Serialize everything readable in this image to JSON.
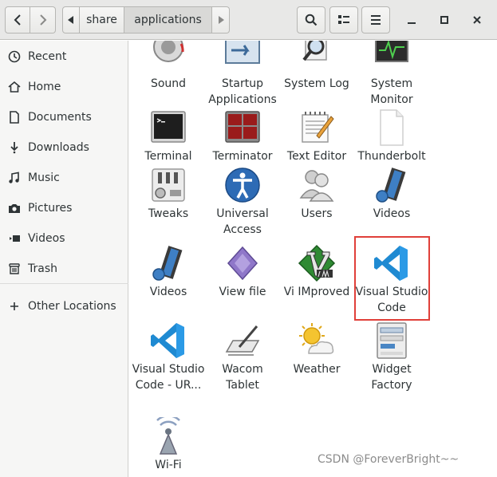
{
  "nav": {
    "back_icon": "chevron-left-icon",
    "forward_icon": "chevron-right-icon"
  },
  "path": {
    "segments": [
      "share",
      "applications"
    ]
  },
  "toolbar": {
    "search_icon": "search-icon",
    "view_icon": "view-toggle-icon",
    "menu_icon": "hamburger-menu-icon"
  },
  "window": {
    "minimize_icon": "minimize-icon",
    "maximize_icon": "maximize-icon",
    "close_icon": "close-icon"
  },
  "sidebar": {
    "items": [
      {
        "label": "Recent",
        "icon": "clock-icon"
      },
      {
        "label": "Home",
        "icon": "home-icon"
      },
      {
        "label": "Documents",
        "icon": "document-icon"
      },
      {
        "label": "Downloads",
        "icon": "download-icon"
      },
      {
        "label": "Music",
        "icon": "music-icon"
      },
      {
        "label": "Pictures",
        "icon": "camera-icon"
      },
      {
        "label": "Videos",
        "icon": "video-icon"
      },
      {
        "label": "Trash",
        "icon": "trash-icon"
      },
      {
        "label": "Other Locations",
        "icon": "plus-icon"
      }
    ]
  },
  "files": [
    {
      "label": "Sound",
      "icon": "sound-icon"
    },
    {
      "label": "Startup Applications",
      "icon": "startup-icon"
    },
    {
      "label": "System Log",
      "icon": "system-log-icon"
    },
    {
      "label": "System Monitor",
      "icon": "system-monitor-icon"
    },
    {
      "label": "Terminal",
      "icon": "terminal-icon"
    },
    {
      "label": "Terminator",
      "icon": "terminator-icon"
    },
    {
      "label": "Text Editor",
      "icon": "text-editor-icon"
    },
    {
      "label": "Thunderbolt",
      "icon": "blank-file-icon"
    },
    {
      "label": "Tweaks",
      "icon": "tweaks-icon"
    },
    {
      "label": "Universal Access",
      "icon": "accessibility-icon"
    },
    {
      "label": "Users",
      "icon": "users-icon"
    },
    {
      "label": "Videos",
      "icon": "film-icon"
    },
    {
      "label": "Videos",
      "icon": "film-icon"
    },
    {
      "label": "View file",
      "icon": "view-file-icon"
    },
    {
      "label": "Vi IMproved",
      "icon": "vim-icon"
    },
    {
      "label": "Visual Studio Code",
      "icon": "vscode-icon"
    },
    {
      "label": "Visual Studio Code - UR...",
      "icon": "vscode-icon"
    },
    {
      "label": "Wacom Tablet",
      "icon": "tablet-icon"
    },
    {
      "label": "Weather",
      "icon": "weather-icon"
    },
    {
      "label": "Widget Factory",
      "icon": "widget-factory-icon"
    },
    {
      "label": "Wi-Fi",
      "icon": "wifi-icon"
    }
  ],
  "watermark": "CSDN @ForeverBright~~",
  "colors": {
    "highlight": "#e0403a",
    "vscode_blue": "#1f8ad2"
  }
}
